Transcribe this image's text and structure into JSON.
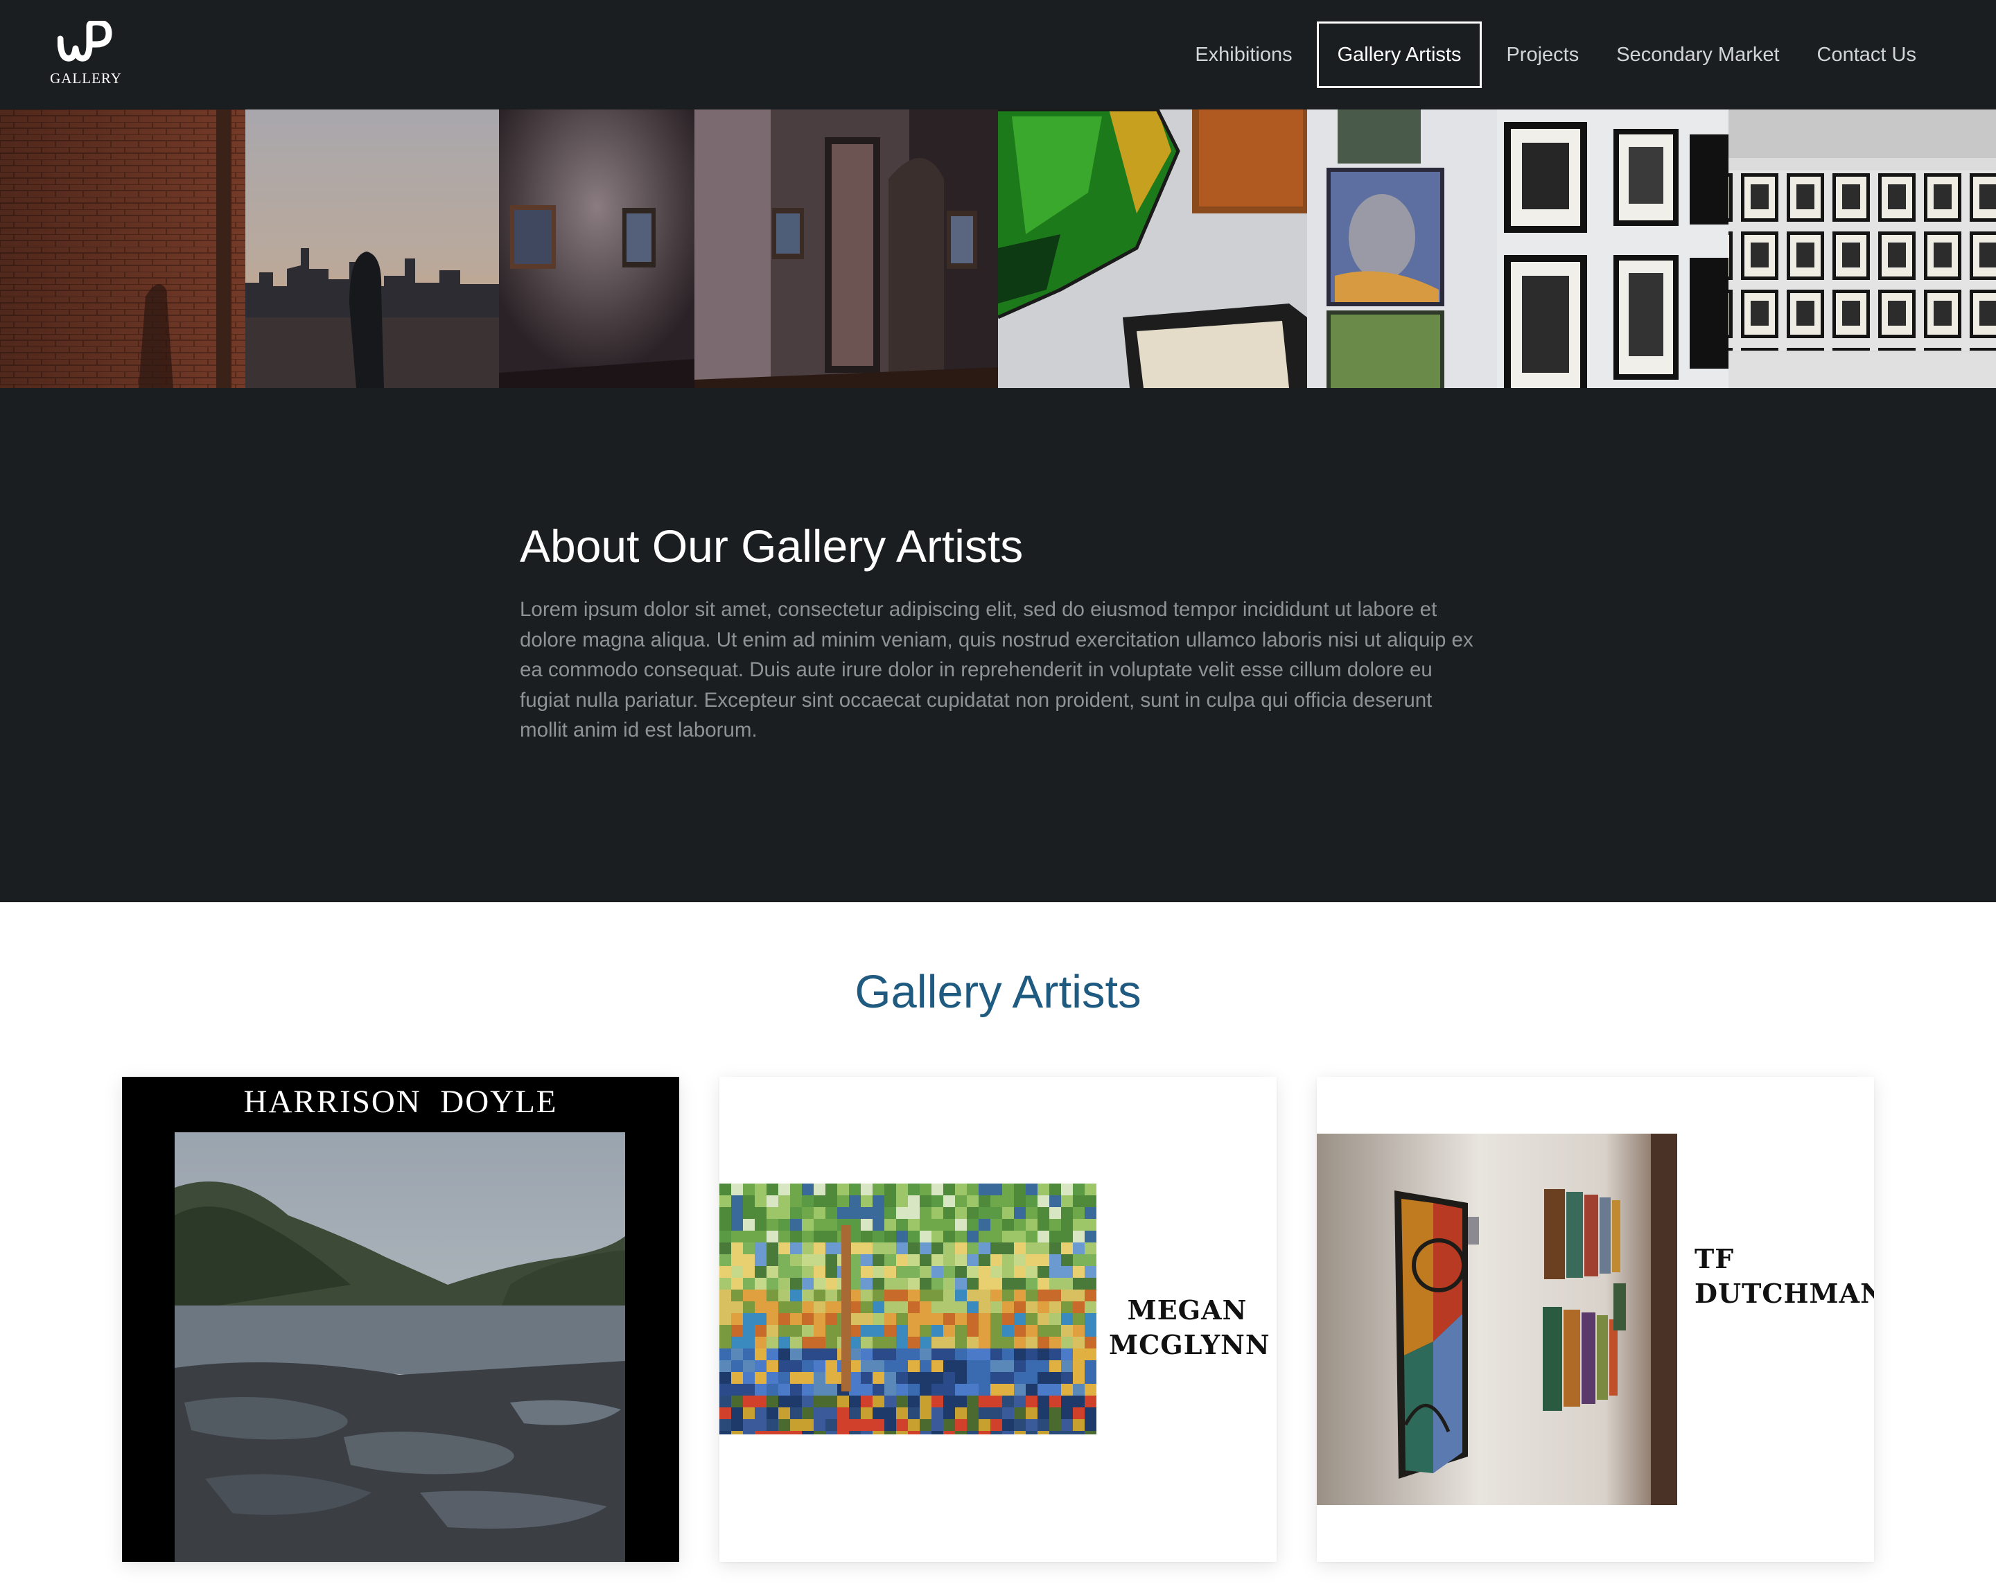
{
  "nav": {
    "logo_text": "GALLERY",
    "links": [
      "Exhibitions",
      "Gallery Artists",
      "Projects",
      "Secondary Market",
      "Contact Us"
    ],
    "active": "Gallery Artists"
  },
  "about": {
    "title": "About Our Gallery Artists",
    "body": "Lorem ipsum dolor sit amet, consectetur adipiscing elit, sed do eiusmod tempor incididunt ut labore et dolore magna aliqua. Ut enim ad minim veniam, quis nostrud exercitation ullamco laboris nisi ut aliquip ex ea commodo consequat. Duis aute irure dolor in reprehenderit in voluptate velit esse cillum dolore eu fugiat nulla pariatur. Excepteur sint occaecat cupidatat non proident, sunt in culpa qui officia deserunt mollit anim id est laborum."
  },
  "artists": {
    "title": "Gallery Artists",
    "cards": [
      {
        "name": "HARRISON  DOYLE"
      },
      {
        "name_line1": "MEGAN",
        "name_line2": "MCGLYNN"
      },
      {
        "name_line1": "TF",
        "name_line2": "DUTCHMAN"
      }
    ]
  },
  "colors": {
    "nav_bg": "#1b1e20",
    "accent_heading": "#1f5a80",
    "body_text_muted": "#8e9397"
  }
}
